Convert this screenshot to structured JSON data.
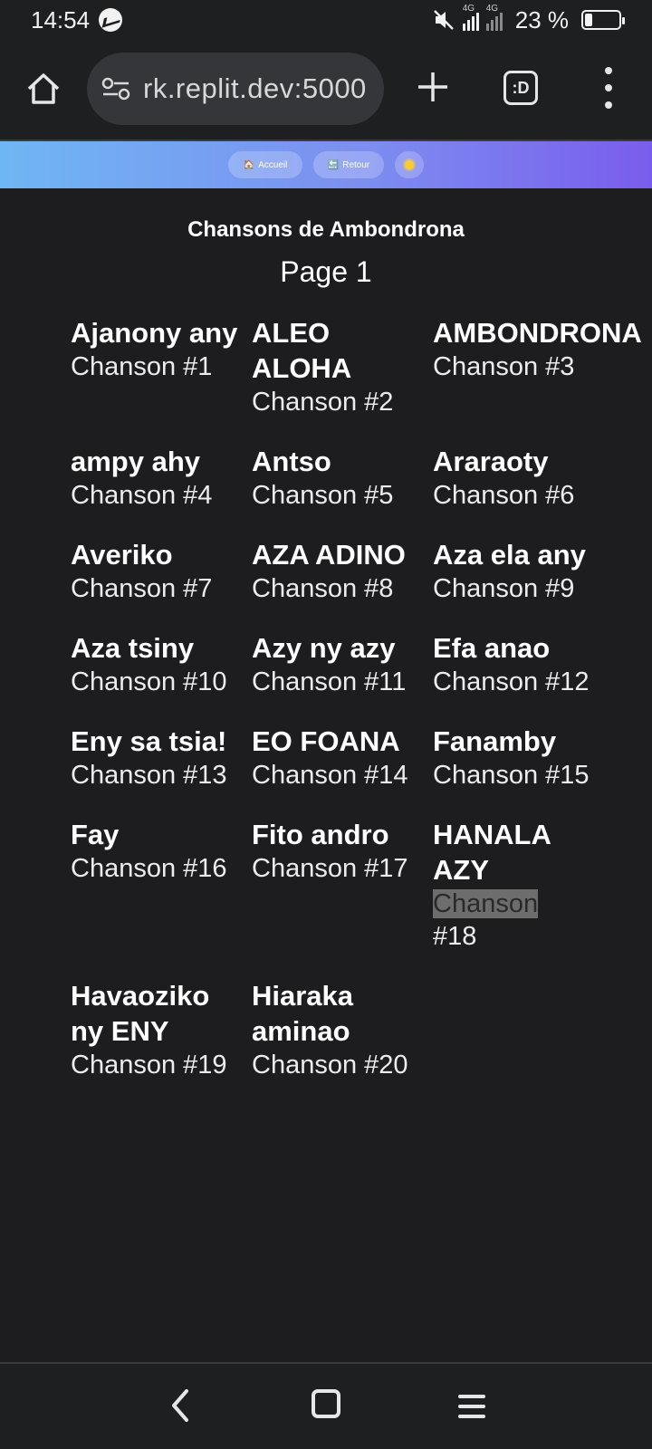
{
  "status": {
    "time": "14:54",
    "net1": "4G",
    "net2": "4G",
    "battery": "23 %"
  },
  "browser": {
    "url": "rk.replit.dev:5000",
    "tab_count": ":D"
  },
  "nav": {
    "home_label": "Accueil",
    "back_label": "Retour",
    "home_emoji": "🏠",
    "back_emoji": "🔙"
  },
  "page": {
    "title": "Chansons de Ambondrona",
    "subtitle": "Page 1"
  },
  "songs": [
    {
      "title": "Ajanony any",
      "number": "Chanson #1"
    },
    {
      "title": "ALEO ALOHA",
      "number": "Chanson #2"
    },
    {
      "title": "AMBONDRONA",
      "number": "Chanson #3"
    },
    {
      "title": "ampy ahy",
      "number": "Chanson #4"
    },
    {
      "title": "Antso",
      "number": "Chanson #5"
    },
    {
      "title": "Araraoty",
      "number": "Chanson #6"
    },
    {
      "title": "Averiko",
      "number": "Chanson #7"
    },
    {
      "title": "AZA ADINO",
      "number": "Chanson #8"
    },
    {
      "title": "Aza ela any",
      "number": "Chanson #9"
    },
    {
      "title": "Aza tsiny",
      "number": "Chanson #10"
    },
    {
      "title": "Azy ny azy",
      "number": "Chanson #11"
    },
    {
      "title": "Efa anao",
      "number": "Chanson #12"
    },
    {
      "title": "Eny sa tsia!",
      "number": "Chanson #13"
    },
    {
      "title": "EO FOANA",
      "number": "Chanson #14"
    },
    {
      "title": "Fanamby",
      "number": "Chanson #15"
    },
    {
      "title": "Fay",
      "number": "Chanson #16"
    },
    {
      "title": "Fito andro",
      "number": "Chanson #17"
    },
    {
      "title": "HANALA AZY",
      "number": "Chanson #18"
    },
    {
      "title": "Havaoziko ny ENY",
      "number": "Chanson #19"
    },
    {
      "title": "Hiaraka aminao",
      "number": "Chanson #20"
    }
  ],
  "highlight": {
    "index": 17,
    "word": "Chanson",
    "rest": "#18"
  }
}
